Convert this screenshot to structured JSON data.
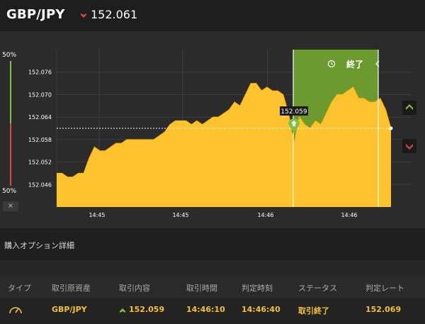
{
  "header": {
    "pair": "GBP/JPY",
    "rate": "152.061",
    "direction": "down"
  },
  "gauge": {
    "top_label": "50%",
    "bottom_label": "50%",
    "close_label": "×",
    "up_color": "#7ec242",
    "down_color": "#e0473c"
  },
  "chart_data": {
    "type": "area",
    "y_ticks": [
      "152.076",
      "152.070",
      "152.064",
      "152.058",
      "152.052",
      "152.046"
    ],
    "x_ticks": [
      "14:45",
      "14:45",
      "14:46",
      "14:46"
    ],
    "ylim": [
      152.04,
      152.082
    ],
    "current_rate": 152.061,
    "entry_label": "152.059",
    "entry_rate": 152.059,
    "expiry_label": "終了",
    "series_color": "#fec32f",
    "expiry_color": "#6c9a2e",
    "values": [
      152.049,
      152.049,
      152.048,
      152.048,
      152.049,
      152.049,
      152.053,
      152.056,
      152.055,
      152.055,
      152.056,
      152.057,
      152.057,
      152.058,
      152.058,
      152.058,
      152.058,
      152.058,
      152.058,
      152.059,
      152.06,
      152.062,
      152.063,
      152.063,
      152.063,
      152.062,
      152.063,
      152.062,
      152.063,
      152.064,
      152.064,
      152.065,
      152.066,
      152.068,
      152.067,
      152.07,
      152.073,
      152.073,
      152.071,
      152.072,
      152.071,
      152.071,
      152.07,
      152.065,
      152.057,
      152.064,
      152.062,
      152.061,
      152.063,
      152.062,
      152.065,
      152.068,
      152.07,
      152.07,
      152.071,
      152.072,
      152.069,
      152.069,
      152.068,
      152.068,
      152.069,
      152.066,
      152.061
    ]
  },
  "section": {
    "title": "購入オプション詳細"
  },
  "table": {
    "headers": [
      "タイプ",
      "取引原資産",
      "取引内容",
      "取引時間",
      "判定時刻",
      "ステータス",
      "判定レート"
    ],
    "row": {
      "type_icon": "gauge-icon",
      "asset": "GBP/JPY",
      "direction": "up",
      "content": "152.059",
      "trade_time": "14:46:10",
      "judge_time": "14:46:40",
      "status": "取引終了",
      "judge_rate": "152.069"
    }
  }
}
